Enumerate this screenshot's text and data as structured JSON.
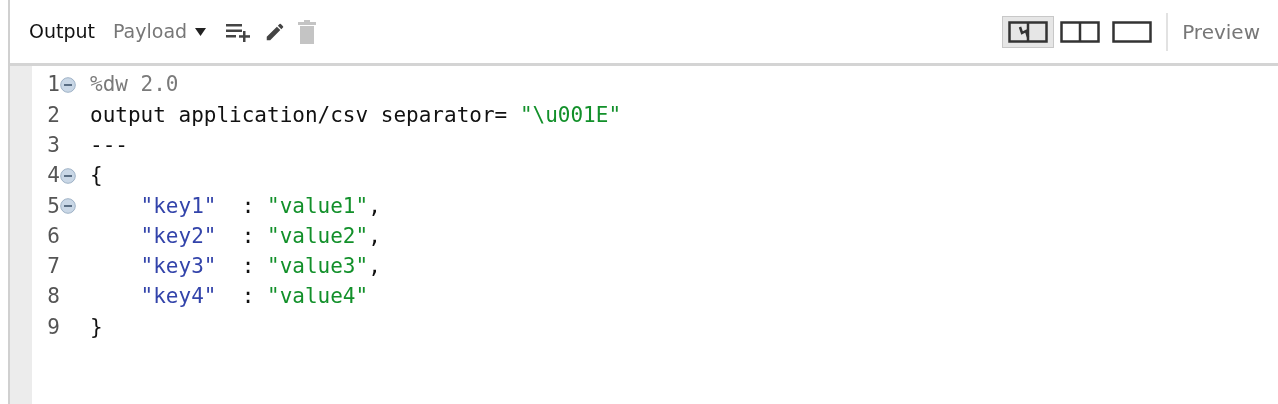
{
  "toolbar": {
    "title": "Output",
    "target": "Payload",
    "tools": [
      {
        "kind": "add-list",
        "disabled": false
      },
      {
        "kind": "edit",
        "disabled": false
      },
      {
        "kind": "delete",
        "disabled": true
      }
    ],
    "layouts": [
      {
        "kind": "diff",
        "selected": true
      },
      {
        "kind": "split",
        "selected": false
      },
      {
        "kind": "single",
        "selected": false
      }
    ],
    "preview": "Preview"
  },
  "editor": {
    "lines": [
      {
        "number": "1",
        "foldable": true,
        "tokens": [
          {
            "kind": "comment",
            "text": "%dw 2.0"
          }
        ]
      },
      {
        "number": "2",
        "foldable": false,
        "tokens": [
          {
            "kind": "plain",
            "text": "output application/csv separator= "
          },
          {
            "kind": "string",
            "text": "\"\\u001E\""
          }
        ]
      },
      {
        "number": "3",
        "foldable": false,
        "tokens": [
          {
            "kind": "plain",
            "text": "---"
          }
        ]
      },
      {
        "number": "4",
        "foldable": true,
        "tokens": [
          {
            "kind": "plain",
            "text": "{"
          }
        ]
      },
      {
        "number": "5",
        "foldable": true,
        "tokens": [
          {
            "kind": "indent"
          },
          {
            "kind": "key",
            "text": "\"key1\""
          },
          {
            "kind": "plain",
            "text": "  : "
          },
          {
            "kind": "string",
            "text": "\"value1\""
          },
          {
            "kind": "plain",
            "text": ","
          }
        ]
      },
      {
        "number": "6",
        "foldable": false,
        "tokens": [
          {
            "kind": "indent"
          },
          {
            "kind": "key",
            "text": "\"key2\""
          },
          {
            "kind": "plain",
            "text": "  : "
          },
          {
            "kind": "string",
            "text": "\"value2\""
          },
          {
            "kind": "plain",
            "text": ","
          }
        ]
      },
      {
        "number": "7",
        "foldable": false,
        "tokens": [
          {
            "kind": "indent"
          },
          {
            "kind": "key",
            "text": "\"key3\""
          },
          {
            "kind": "plain",
            "text": "  : "
          },
          {
            "kind": "string",
            "text": "\"value3\""
          },
          {
            "kind": "plain",
            "text": ","
          }
        ]
      },
      {
        "number": "8",
        "foldable": false,
        "tokens": [
          {
            "kind": "indent"
          },
          {
            "kind": "key",
            "text": "\"key4\""
          },
          {
            "kind": "plain",
            "text": "  : "
          },
          {
            "kind": "string",
            "text": "\"value4\""
          }
        ]
      },
      {
        "number": "9",
        "foldable": false,
        "tokens": [
          {
            "kind": "plain",
            "text": "}"
          }
        ]
      }
    ]
  }
}
